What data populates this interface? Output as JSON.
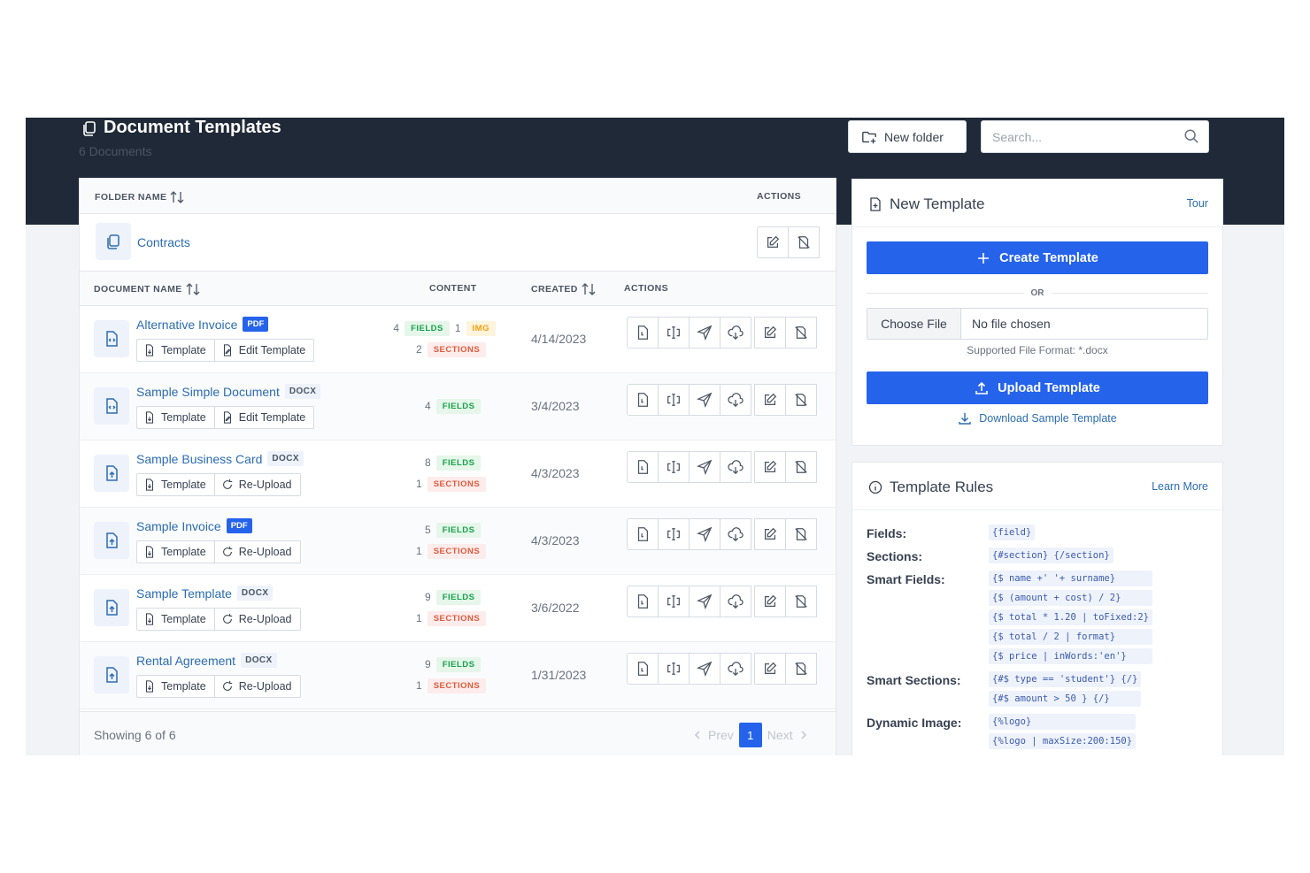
{
  "header": {
    "title": "Document Templates",
    "subtitle": "6 Documents",
    "new_folder_label": "New folder",
    "search_placeholder": "Search..."
  },
  "folder_table": {
    "col_name": "FOLDER NAME",
    "col_actions": "ACTIONS",
    "folders": [
      {
        "name": "Contracts"
      }
    ]
  },
  "doc_table": {
    "col_name": "DOCUMENT NAME",
    "col_content": "CONTENT",
    "col_created": "CREATED",
    "col_actions": "ACTIONS",
    "rows": [
      {
        "name": "Alternative Invoice",
        "format": "PDF",
        "btn1": "Template",
        "btn2": "Edit Template",
        "fields": "4",
        "fields_label": "FIELDS",
        "img": "1",
        "img_label": "IMG",
        "sections": "2",
        "sections_label": "SECTIONS",
        "created": "4/14/2023"
      },
      {
        "name": "Sample Simple Document",
        "format": "DOCX",
        "btn1": "Template",
        "btn2": "Edit Template",
        "fields": "4",
        "fields_label": "FIELDS",
        "created": "3/4/2023"
      },
      {
        "name": "Sample Business Card",
        "format": "DOCX",
        "btn1": "Template",
        "btn2": "Re-Upload",
        "fields": "8",
        "fields_label": "FIELDS",
        "sections": "1",
        "sections_label": "SECTIONS",
        "created": "4/3/2023"
      },
      {
        "name": "Sample Invoice",
        "format": "PDF",
        "btn1": "Template",
        "btn2": "Re-Upload",
        "fields": "5",
        "fields_label": "FIELDS",
        "sections": "1",
        "sections_label": "SECTIONS",
        "created": "4/3/2023"
      },
      {
        "name": "Sample Template",
        "format": "DOCX",
        "btn1": "Template",
        "btn2": "Re-Upload",
        "fields": "9",
        "fields_label": "FIELDS",
        "sections": "1",
        "sections_label": "SECTIONS",
        "created": "3/6/2022"
      },
      {
        "name": "Rental Agreement",
        "format": "DOCX",
        "btn1": "Template",
        "btn2": "Re-Upload",
        "fields": "9",
        "fields_label": "FIELDS",
        "sections": "1",
        "sections_label": "SECTIONS",
        "created": "1/31/2023"
      }
    ]
  },
  "footer": {
    "showing": "Showing 6 of 6",
    "prev": "Prev",
    "page": "1",
    "next": "Next"
  },
  "new_template": {
    "title": "New Template",
    "tour": "Tour",
    "create_label": "Create Template",
    "or_label": "OR",
    "choose_file": "Choose File",
    "no_file": "No file chosen",
    "supported": "Supported File Format: *.docx",
    "upload_label": "Upload Template",
    "download_label": "Download Sample Template"
  },
  "rules": {
    "title": "Template Rules",
    "learn_more": "Learn More",
    "items": [
      {
        "label": "Fields:",
        "codes": [
          "{field}"
        ]
      },
      {
        "label": "Sections:",
        "codes": [
          "{#section} {/section}"
        ]
      },
      {
        "label": "Smart Fields:",
        "codes": [
          "{$ name +' '+ surname}",
          "{$ (amount + cost) / 2}",
          "{$ total * 1.20 | toFixed:2}",
          "{$ total / 2 | format}",
          "{$ price | inWords:'en'}"
        ]
      },
      {
        "label": "Smart Sections:",
        "codes": [
          "{#$ type == 'student'} {/}",
          "{#$ amount > 50 } {/}"
        ]
      },
      {
        "label": "Dynamic Image:",
        "codes": [
          "{%logo}",
          "{%logo | maxSize:200:150}"
        ]
      }
    ]
  },
  "colors": {
    "primary": "#2563eb",
    "header_bg": "#1f2937",
    "link": "#2b6cb0",
    "fields_tag": "#16a34a",
    "sections_tag": "#e05a3a",
    "img_tag": "#f59e0b"
  }
}
